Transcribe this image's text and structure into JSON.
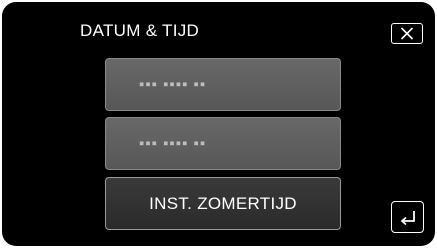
{
  "header": {
    "title": "DATUM & TIJD"
  },
  "menu": {
    "items": [
      {
        "label": "▪▪▪ ▪▪▪▪ ▪▪",
        "state": "disabled"
      },
      {
        "label": "▪▪▪ ▪▪▪▪ ▪▪",
        "state": "disabled"
      },
      {
        "label": "INST. ZOMERTIJD",
        "state": "enabled"
      }
    ]
  },
  "icons": {
    "close": "close-icon",
    "back": "back-arrow-icon"
  },
  "colors": {
    "background": "#000000",
    "disabled_button": "#5f5f5f",
    "enabled_button": "#333333",
    "text": "#ffffff"
  }
}
